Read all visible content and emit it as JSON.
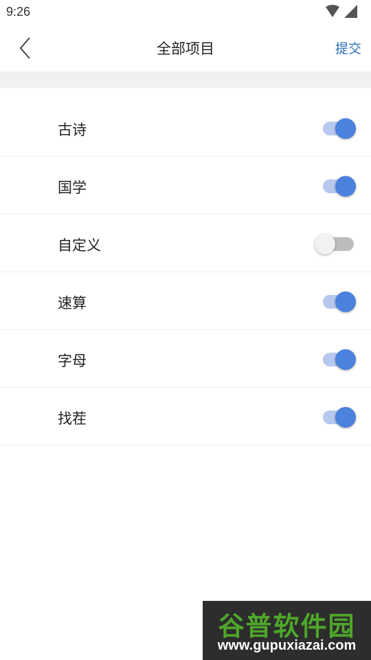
{
  "status_bar": {
    "time": "9:26",
    "icons": [
      "wifi-icon",
      "cellular-signal-icon"
    ]
  },
  "header": {
    "back_icon": "chevron-left-icon",
    "title": "全部项目",
    "submit_label": "提交"
  },
  "items": [
    {
      "label": "古诗",
      "enabled": true
    },
    {
      "label": "国学",
      "enabled": true
    },
    {
      "label": "自定义",
      "enabled": false
    },
    {
      "label": "速算",
      "enabled": true
    },
    {
      "label": "字母",
      "enabled": true
    },
    {
      "label": "找茬",
      "enabled": true
    }
  ],
  "watermark": {
    "logo_text": "谷普软件园",
    "url": "www.gupuxiazai.com"
  },
  "colors": {
    "accent": "#2f6fc0",
    "toggle_on_knob": "#4a82dd",
    "toggle_on_track": "#b7c8ee",
    "toggle_off_knob": "#f2f2f2",
    "toggle_off_track": "#bdbdbd",
    "section_band": "#f1f1f1"
  }
}
